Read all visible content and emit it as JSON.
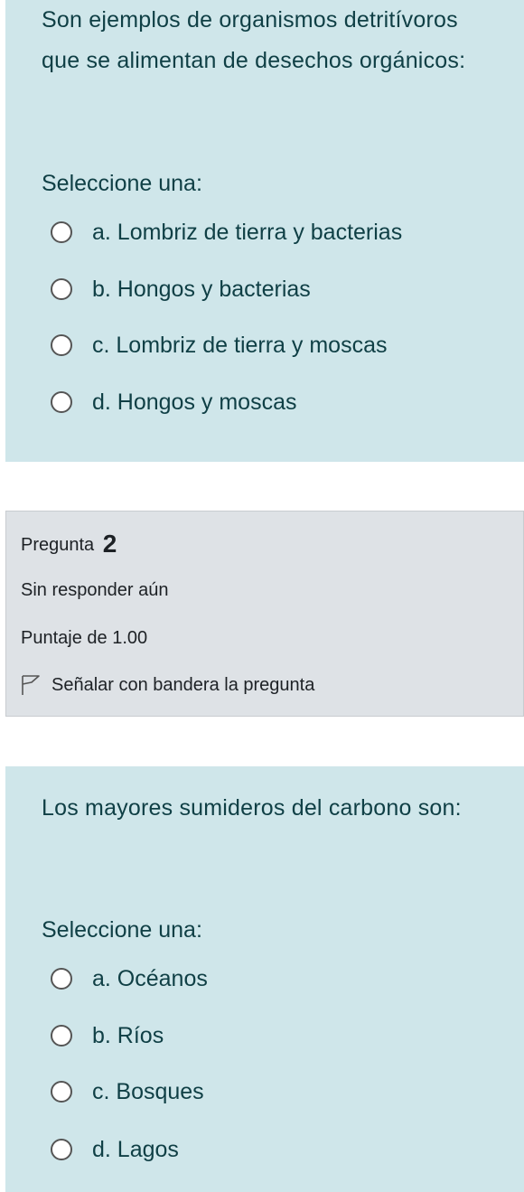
{
  "question1": {
    "text": "Son ejemplos de organismos detritívoros que se alimentan de desechos orgánicos:",
    "prompt": "Seleccione una:",
    "options": [
      "a. Lombriz de tierra y bacterias",
      "b. Hongos y bacterias",
      "c. Lombriz de tierra y moscas",
      "d. Hongos y moscas"
    ]
  },
  "question2_info": {
    "label": "Pregunta",
    "number": "2",
    "status": "Sin responder aún",
    "score": "Puntaje de 1.00",
    "flag_label": "Señalar con bandera la pregunta",
    "flag_icon": "flag-outline-icon"
  },
  "question2": {
    "text": "Los mayores sumideros del carbono son:",
    "prompt": "Seleccione una:",
    "options": [
      "a. Océanos",
      "b. Ríos",
      "c. Bosques",
      "d. Lagos"
    ]
  },
  "colors": {
    "question_bg": "#cfe6ea",
    "question_text": "#0f3f45",
    "info_bg": "#dee2e6",
    "radio_border": "#555555"
  }
}
